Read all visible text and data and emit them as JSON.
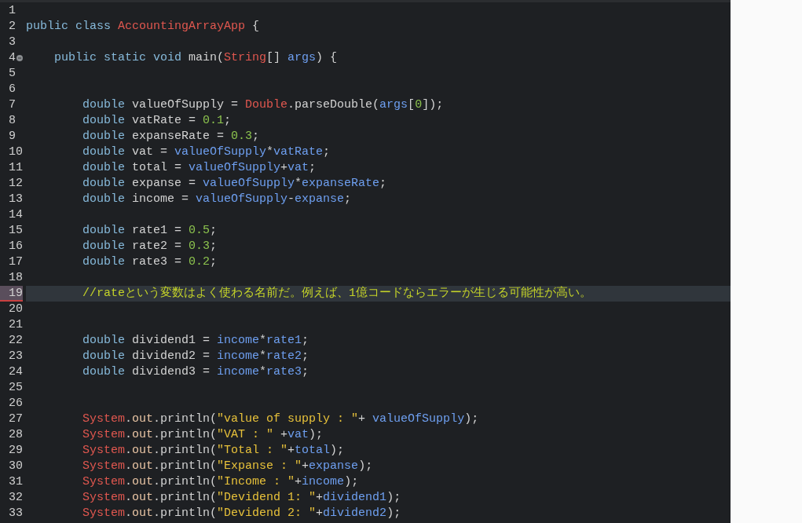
{
  "editor": {
    "lines": [
      {
        "number": "1",
        "current": false,
        "fold": false,
        "kind": "blank"
      },
      {
        "number": "2",
        "current": false,
        "fold": false,
        "kind": "class",
        "tokens": [
          {
            "kind": "keyword",
            "text": "public class "
          },
          {
            "kind": "type",
            "text": "AccountingArrayApp"
          },
          {
            "kind": "plain",
            "text": " {"
          }
        ]
      },
      {
        "number": "3",
        "current": false,
        "fold": false,
        "kind": "blank"
      },
      {
        "number": "4",
        "current": false,
        "fold": true,
        "kind": "method",
        "tokens": [
          {
            "kind": "keyword",
            "text": "public static void "
          },
          {
            "kind": "plain",
            "text": "main("
          },
          {
            "kind": "type",
            "text": "String"
          },
          {
            "kind": "plain",
            "text": "[] "
          },
          {
            "kind": "variable",
            "text": "args"
          },
          {
            "kind": "plain",
            "text": ") {"
          }
        ]
      },
      {
        "number": "5",
        "current": false,
        "fold": false,
        "kind": "blank"
      },
      {
        "number": "6",
        "current": false,
        "fold": false,
        "kind": "blank"
      },
      {
        "number": "7",
        "current": false,
        "fold": false,
        "kind": "statement",
        "tokens": [
          {
            "kind": "keyword",
            "text": "double "
          },
          {
            "kind": "plain",
            "text": "valueOfSupply = "
          },
          {
            "kind": "type",
            "text": "Double"
          },
          {
            "kind": "plain",
            "text": ".parseDouble("
          },
          {
            "kind": "variable",
            "text": "args"
          },
          {
            "kind": "plain",
            "text": "["
          },
          {
            "kind": "number",
            "text": "0"
          },
          {
            "kind": "plain",
            "text": "]);"
          }
        ]
      },
      {
        "number": "8",
        "current": false,
        "fold": false,
        "kind": "statement",
        "tokens": [
          {
            "kind": "keyword",
            "text": "double "
          },
          {
            "kind": "plain",
            "text": "vatRate = "
          },
          {
            "kind": "number",
            "text": "0.1"
          },
          {
            "kind": "plain",
            "text": ";"
          }
        ]
      },
      {
        "number": "9",
        "current": false,
        "fold": false,
        "kind": "statement",
        "tokens": [
          {
            "kind": "keyword",
            "text": "double "
          },
          {
            "kind": "plain",
            "text": "expanseRate = "
          },
          {
            "kind": "number",
            "text": "0.3"
          },
          {
            "kind": "plain",
            "text": ";"
          }
        ]
      },
      {
        "number": "10",
        "current": false,
        "fold": false,
        "kind": "statement",
        "tokens": [
          {
            "kind": "keyword",
            "text": "double "
          },
          {
            "kind": "plain",
            "text": "vat = "
          },
          {
            "kind": "variable",
            "text": "valueOfSupply"
          },
          {
            "kind": "plain",
            "text": "*"
          },
          {
            "kind": "variable",
            "text": "vatRate"
          },
          {
            "kind": "plain",
            "text": ";"
          }
        ]
      },
      {
        "number": "11",
        "current": false,
        "fold": false,
        "kind": "statement",
        "tokens": [
          {
            "kind": "keyword",
            "text": "double "
          },
          {
            "kind": "plain",
            "text": "total = "
          },
          {
            "kind": "variable",
            "text": "valueOfSupply"
          },
          {
            "kind": "plain",
            "text": "+"
          },
          {
            "kind": "variable",
            "text": "vat"
          },
          {
            "kind": "plain",
            "text": ";"
          }
        ]
      },
      {
        "number": "12",
        "current": false,
        "fold": false,
        "kind": "statement",
        "tokens": [
          {
            "kind": "keyword",
            "text": "double "
          },
          {
            "kind": "plain",
            "text": "expanse = "
          },
          {
            "kind": "variable",
            "text": "valueOfSupply"
          },
          {
            "kind": "plain",
            "text": "*"
          },
          {
            "kind": "variable",
            "text": "expanseRate"
          },
          {
            "kind": "plain",
            "text": ";"
          }
        ]
      },
      {
        "number": "13",
        "current": false,
        "fold": false,
        "kind": "statement",
        "tokens": [
          {
            "kind": "keyword",
            "text": "double "
          },
          {
            "kind": "plain",
            "text": "income = "
          },
          {
            "kind": "variable",
            "text": "valueOfSupply"
          },
          {
            "kind": "plain",
            "text": "-"
          },
          {
            "kind": "variable",
            "text": "expanse"
          },
          {
            "kind": "plain",
            "text": ";"
          }
        ]
      },
      {
        "number": "14",
        "current": false,
        "fold": false,
        "kind": "blank"
      },
      {
        "number": "15",
        "current": false,
        "fold": false,
        "kind": "statement",
        "tokens": [
          {
            "kind": "keyword",
            "text": "double "
          },
          {
            "kind": "plain",
            "text": "rate1 = "
          },
          {
            "kind": "number",
            "text": "0.5"
          },
          {
            "kind": "plain",
            "text": ";"
          }
        ]
      },
      {
        "number": "16",
        "current": false,
        "fold": false,
        "kind": "statement",
        "tokens": [
          {
            "kind": "keyword",
            "text": "double "
          },
          {
            "kind": "plain",
            "text": "rate2 = "
          },
          {
            "kind": "number",
            "text": "0.3"
          },
          {
            "kind": "plain",
            "text": ";"
          }
        ]
      },
      {
        "number": "17",
        "current": false,
        "fold": false,
        "kind": "statement",
        "tokens": [
          {
            "kind": "keyword",
            "text": "double "
          },
          {
            "kind": "plain",
            "text": "rate3 = "
          },
          {
            "kind": "number",
            "text": "0.2"
          },
          {
            "kind": "plain",
            "text": ";"
          }
        ]
      },
      {
        "number": "18",
        "current": false,
        "fold": false,
        "kind": "blank"
      },
      {
        "number": "19",
        "current": true,
        "fold": false,
        "kind": "statement",
        "tokens": [
          {
            "kind": "comment",
            "text": "//rateという変数はよく使わる名前だ。例えば、1億コードならエラーが生じる可能性が高い。"
          }
        ]
      },
      {
        "number": "20",
        "current": false,
        "fold": false,
        "kind": "blank"
      },
      {
        "number": "21",
        "current": false,
        "fold": false,
        "kind": "blank"
      },
      {
        "number": "22",
        "current": false,
        "fold": false,
        "kind": "statement",
        "tokens": [
          {
            "kind": "keyword",
            "text": "double "
          },
          {
            "kind": "plain",
            "text": "dividend1 = "
          },
          {
            "kind": "variable",
            "text": "income"
          },
          {
            "kind": "plain",
            "text": "*"
          },
          {
            "kind": "variable",
            "text": "rate1"
          },
          {
            "kind": "plain",
            "text": ";"
          }
        ]
      },
      {
        "number": "23",
        "current": false,
        "fold": false,
        "kind": "statement",
        "tokens": [
          {
            "kind": "keyword",
            "text": "double "
          },
          {
            "kind": "plain",
            "text": "dividend2 = "
          },
          {
            "kind": "variable",
            "text": "income"
          },
          {
            "kind": "plain",
            "text": "*"
          },
          {
            "kind": "variable",
            "text": "rate2"
          },
          {
            "kind": "plain",
            "text": ";"
          }
        ]
      },
      {
        "number": "24",
        "current": false,
        "fold": false,
        "kind": "statement",
        "tokens": [
          {
            "kind": "keyword",
            "text": "double "
          },
          {
            "kind": "plain",
            "text": "dividend3 = "
          },
          {
            "kind": "variable",
            "text": "income"
          },
          {
            "kind": "plain",
            "text": "*"
          },
          {
            "kind": "variable",
            "text": "rate3"
          },
          {
            "kind": "plain",
            "text": ";"
          }
        ]
      },
      {
        "number": "25",
        "current": false,
        "fold": false,
        "kind": "blank"
      },
      {
        "number": "26",
        "current": false,
        "fold": false,
        "kind": "blank"
      },
      {
        "number": "27",
        "current": false,
        "fold": false,
        "kind": "statement",
        "tokens": [
          {
            "kind": "type",
            "text": "System"
          },
          {
            "kind": "plain",
            "text": "."
          },
          {
            "kind": "field",
            "text": "out"
          },
          {
            "kind": "plain",
            "text": ".println("
          },
          {
            "kind": "string",
            "text": "\"value of supply : \""
          },
          {
            "kind": "plain",
            "text": "+ "
          },
          {
            "kind": "variable",
            "text": "valueOfSupply"
          },
          {
            "kind": "plain",
            "text": ");"
          }
        ]
      },
      {
        "number": "28",
        "current": false,
        "fold": false,
        "kind": "statement",
        "tokens": [
          {
            "kind": "type",
            "text": "System"
          },
          {
            "kind": "plain",
            "text": "."
          },
          {
            "kind": "field",
            "text": "out"
          },
          {
            "kind": "plain",
            "text": ".println("
          },
          {
            "kind": "string",
            "text": "\"VAT : \""
          },
          {
            "kind": "plain",
            "text": " +"
          },
          {
            "kind": "variable",
            "text": "vat"
          },
          {
            "kind": "plain",
            "text": ");"
          }
        ]
      },
      {
        "number": "29",
        "current": false,
        "fold": false,
        "kind": "statement",
        "tokens": [
          {
            "kind": "type",
            "text": "System"
          },
          {
            "kind": "plain",
            "text": "."
          },
          {
            "kind": "field",
            "text": "out"
          },
          {
            "kind": "plain",
            "text": ".println("
          },
          {
            "kind": "string",
            "text": "\"Total : \""
          },
          {
            "kind": "plain",
            "text": "+"
          },
          {
            "kind": "variable",
            "text": "total"
          },
          {
            "kind": "plain",
            "text": ");"
          }
        ]
      },
      {
        "number": "30",
        "current": false,
        "fold": false,
        "kind": "statement",
        "tokens": [
          {
            "kind": "type",
            "text": "System"
          },
          {
            "kind": "plain",
            "text": "."
          },
          {
            "kind": "field",
            "text": "out"
          },
          {
            "kind": "plain",
            "text": ".println("
          },
          {
            "kind": "string",
            "text": "\"Expanse : \""
          },
          {
            "kind": "plain",
            "text": "+"
          },
          {
            "kind": "variable",
            "text": "expanse"
          },
          {
            "kind": "plain",
            "text": ");"
          }
        ]
      },
      {
        "number": "31",
        "current": false,
        "fold": false,
        "kind": "statement",
        "tokens": [
          {
            "kind": "type",
            "text": "System"
          },
          {
            "kind": "plain",
            "text": "."
          },
          {
            "kind": "field",
            "text": "out"
          },
          {
            "kind": "plain",
            "text": ".println("
          },
          {
            "kind": "string",
            "text": "\"Income : \""
          },
          {
            "kind": "plain",
            "text": "+"
          },
          {
            "kind": "variable",
            "text": "income"
          },
          {
            "kind": "plain",
            "text": ");"
          }
        ]
      },
      {
        "number": "32",
        "current": false,
        "fold": false,
        "kind": "statement",
        "tokens": [
          {
            "kind": "type",
            "text": "System"
          },
          {
            "kind": "plain",
            "text": "."
          },
          {
            "kind": "field",
            "text": "out"
          },
          {
            "kind": "plain",
            "text": ".println("
          },
          {
            "kind": "string",
            "text": "\"Devidend 1: \""
          },
          {
            "kind": "plain",
            "text": "+"
          },
          {
            "kind": "variable",
            "text": "dividend1"
          },
          {
            "kind": "plain",
            "text": ");"
          }
        ]
      },
      {
        "number": "33",
        "current": false,
        "fold": false,
        "kind": "statement",
        "tokens": [
          {
            "kind": "type",
            "text": "System"
          },
          {
            "kind": "plain",
            "text": "."
          },
          {
            "kind": "field",
            "text": "out"
          },
          {
            "kind": "plain",
            "text": ".println("
          },
          {
            "kind": "string",
            "text": "\"Devidend 2: \""
          },
          {
            "kind": "plain",
            "text": "+"
          },
          {
            "kind": "variable",
            "text": "dividend2"
          },
          {
            "kind": "plain",
            "text": ");"
          }
        ]
      }
    ]
  }
}
